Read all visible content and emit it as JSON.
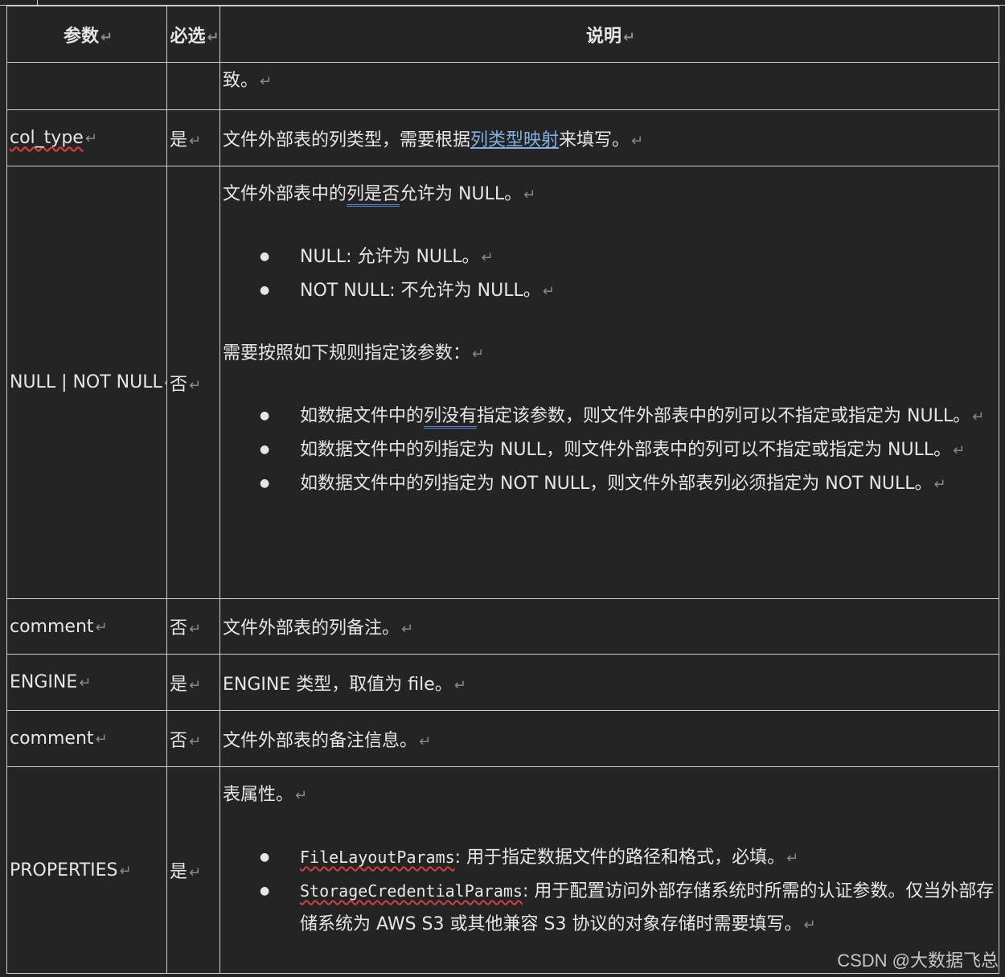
{
  "table": {
    "headers": [
      "参数",
      "必选",
      "说明"
    ],
    "rows": {
      "r0": {
        "desc": "致。"
      },
      "r1": {
        "param": "col_type",
        "required": "是",
        "desc_pre": "文件外部表的列类型，需要根据",
        "desc_link": "列类型映射",
        "desc_post": "来填写。"
      },
      "r2": {
        "param": "NULL | NOT NULL",
        "required": "否",
        "p1_pre": "文件外部表中的",
        "p1_mark": "列是否",
        "p1_post": "允许为  NULL。",
        "b1": "NULL:  允许为  NULL。",
        "b2": "NOT NULL:  不允许为  NULL。",
        "p2": "需要按照如下规则指定该参数：",
        "b3_pre": "如数据文件中的",
        "b3_mark": "列没有",
        "b3_post": "指定该参数，则文件外部表中的列可以不指定或指定为  NULL。",
        "b4": "如数据文件中的列指定为  NULL，则文件外部表中的列可以不指定或指定为  NULL。",
        "b5": "如数据文件中的列指定为  NOT NULL，则文件外部表列必须指定为  NOT NULL。"
      },
      "r3": {
        "param": "comment",
        "required": "否",
        "desc": "文件外部表的列备注。"
      },
      "r4": {
        "param": "ENGINE",
        "required": "是",
        "desc": "ENGINE  类型，取值为  file。"
      },
      "r5": {
        "param": "comment",
        "required": "否",
        "desc": "文件外部表的备注信息。"
      },
      "r6": {
        "param": "PROPERTIES",
        "required": "是",
        "p1": "表属性。",
        "b1_code": "FileLayoutParams",
        "b1_text": ":  用于指定数据文件的路径和格式，必填。",
        "b2_code": "StorageCredentialParams",
        "b2_text": ":  用于配置访问外部存储系统时所需的认证参数。仅当外部存储系统为  AWS S3  或其他兼容  S3  协议的对象存储时需要填写。"
      }
    }
  },
  "return_mark": "↵",
  "watermark": "CSDN @大数据飞总"
}
